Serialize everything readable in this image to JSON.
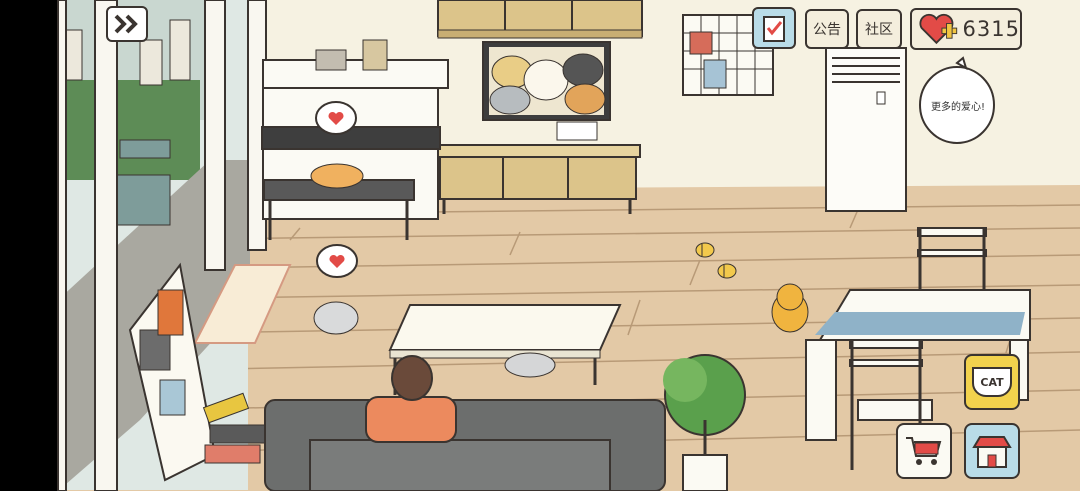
{
  "hud": {
    "announcement_label": "公告",
    "community_label": "社区",
    "hearts_count": "6315"
  },
  "speech_bubble": {
    "text": "更多的爱心!"
  },
  "buttons": {
    "cat_food_label": "CAT"
  },
  "colors": {
    "wall": "#f6f2e2",
    "floor": "#e3c9a6",
    "floor_lines": "#b89a77",
    "furniture_wood": "#dcc48a",
    "sofa": "#6c6e6d",
    "heart_button": "#e24b47",
    "outline": "#3a3430"
  },
  "icons": {
    "skip": "double-chevron-right-icon",
    "tasks": "clipboard-check-icon",
    "hearts": "heart-plus-icon",
    "cat_food": "cat-food-bowl-icon",
    "shop": "shopping-cart-icon",
    "store": "storefront-icon"
  }
}
